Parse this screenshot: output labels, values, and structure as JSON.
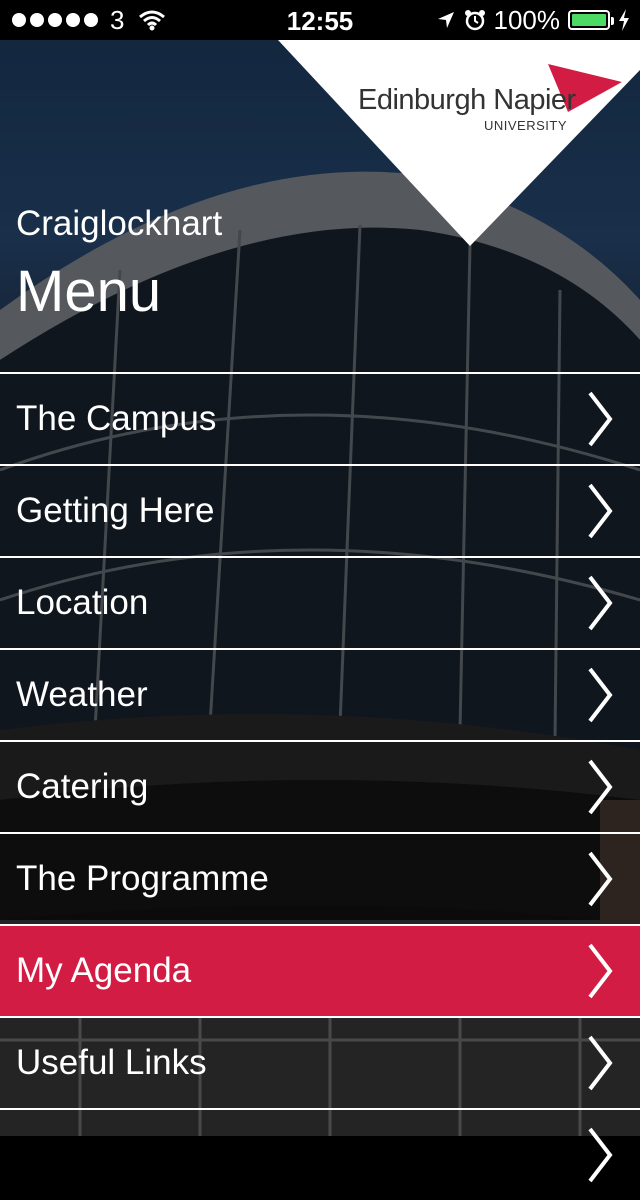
{
  "status_bar": {
    "carrier": "3",
    "time": "12:55",
    "battery_percent": "100%",
    "battery_color": "#4cd964"
  },
  "logo": {
    "name": "Edinburgh Napier",
    "sub": "UNIVERSITY",
    "accent_color": "#d31c44"
  },
  "header": {
    "subtitle": "Craiglockhart",
    "title": "Menu"
  },
  "menu": {
    "items": [
      {
        "label": "The Campus"
      },
      {
        "label": "Getting Here"
      },
      {
        "label": "Location"
      },
      {
        "label": "Weather"
      },
      {
        "label": "Catering"
      },
      {
        "label": "The Programme"
      },
      {
        "label": "My Agenda",
        "active": true
      },
      {
        "label": "Useful Links"
      }
    ]
  }
}
